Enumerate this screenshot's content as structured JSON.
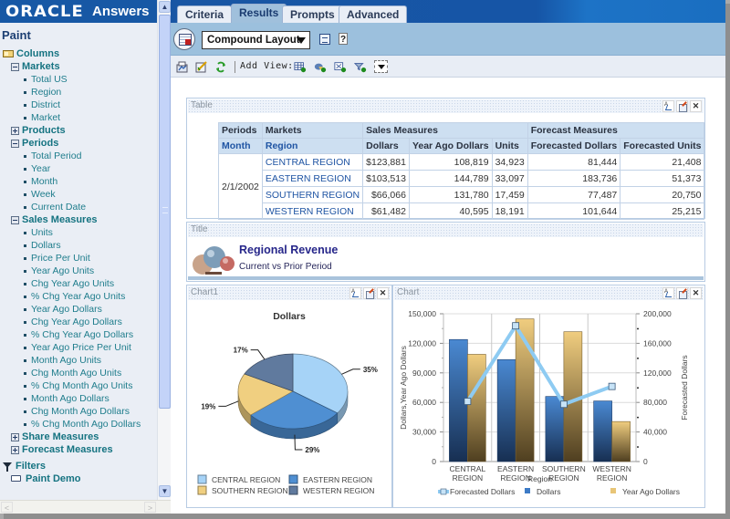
{
  "brand": {
    "logo": "ORACLE",
    "product": "Answers"
  },
  "left_panel": {
    "title": "Paint",
    "tree": [
      {
        "label": "Columns",
        "level": 0,
        "icon": "columns-folder-icon"
      },
      {
        "label": "Markets",
        "level": 1,
        "toggle": "minus"
      },
      {
        "label": "Total US",
        "level": 2
      },
      {
        "label": "Region",
        "level": 2
      },
      {
        "label": "District",
        "level": 2
      },
      {
        "label": "Market",
        "level": 2
      },
      {
        "label": "Products",
        "level": 1,
        "toggle": "plus"
      },
      {
        "label": "Periods",
        "level": 1,
        "toggle": "minus"
      },
      {
        "label": "Total Period",
        "level": 2
      },
      {
        "label": "Year",
        "level": 2
      },
      {
        "label": "Month",
        "level": 2
      },
      {
        "label": "Week",
        "level": 2
      },
      {
        "label": "Current Date",
        "level": 2
      },
      {
        "label": "Sales Measures",
        "level": 1,
        "toggle": "minus"
      },
      {
        "label": "Units",
        "level": 2
      },
      {
        "label": "Dollars",
        "level": 2
      },
      {
        "label": "Price Per Unit",
        "level": 2
      },
      {
        "label": "Year Ago Units",
        "level": 2
      },
      {
        "label": "Chg Year Ago Units",
        "level": 2
      },
      {
        "label": "% Chg Year Ago Units",
        "level": 2
      },
      {
        "label": "Year Ago Dollars",
        "level": 2
      },
      {
        "label": "Chg Year Ago Dollars",
        "level": 2
      },
      {
        "label": "% Chg Year Ago Dollars",
        "level": 2
      },
      {
        "label": "Year Ago Price Per Unit",
        "level": 2
      },
      {
        "label": "Month Ago Units",
        "level": 2
      },
      {
        "label": "Chg Month Ago Units",
        "level": 2
      },
      {
        "label": "% Chg Month Ago Units",
        "level": 2
      },
      {
        "label": "Month Ago Dollars",
        "level": 2
      },
      {
        "label": "Chg Month Ago Dollars",
        "level": 2
      },
      {
        "label": "% Chg Month Ago Dollars",
        "level": 2
      },
      {
        "label": "Share Measures",
        "level": 1,
        "toggle": "plus"
      },
      {
        "label": "Forecast Measures",
        "level": 1,
        "toggle": "plus"
      }
    ],
    "filters_label": "Filters",
    "filters_item": "Paint Demo"
  },
  "tabs": [
    {
      "label": "Criteria",
      "active": false
    },
    {
      "label": "Results",
      "active": true
    },
    {
      "label": "Prompts",
      "active": false
    },
    {
      "label": "Advanced",
      "active": false
    }
  ],
  "toolbar": {
    "layout_select": "Compound Layout",
    "help_glyph": "?",
    "add_view_label": "Add View:"
  },
  "table_view": {
    "title": "Table",
    "header_row1": {
      "periods": "Periods",
      "markets": "Markets",
      "sales": "Sales Measures",
      "forecast": "Forecast Measures"
    },
    "header_row2": [
      "Month",
      "Region",
      "Dollars",
      "Year Ago Dollars",
      "Units",
      "Forecasted Dollars",
      "Forecasted Units"
    ],
    "month": "2/1/2002",
    "rows": [
      {
        "region": "CENTRAL REGION",
        "dollars": "$123,881",
        "year_ago_dollars": "108,819",
        "units": "34,923",
        "forecasted_dollars": "81,444",
        "forecasted_units": "21,408"
      },
      {
        "region": "EASTERN REGION",
        "dollars": "$103,513",
        "year_ago_dollars": "144,789",
        "units": "33,097",
        "forecasted_dollars": "183,736",
        "forecasted_units": "51,373"
      },
      {
        "region": "SOUTHERN REGION",
        "dollars": "$66,066",
        "year_ago_dollars": "131,780",
        "units": "17,459",
        "forecasted_dollars": "77,487",
        "forecasted_units": "20,750"
      },
      {
        "region": "WESTERN REGION",
        "dollars": "$61,482",
        "year_ago_dollars": "40,595",
        "units": "18,191",
        "forecasted_dollars": "101,644",
        "forecasted_units": "25,215"
      }
    ]
  },
  "title_view": {
    "label": "Title",
    "title": "Regional Revenue",
    "subtitle": "Current vs Prior Period"
  },
  "panel_buttons": {
    "close": "✕"
  },
  "chart_data": [
    {
      "panel_label": "Chart1",
      "type": "pie",
      "title": "Dollars",
      "style": "3d",
      "slices": [
        {
          "label": "CENTRAL REGION",
          "value": 123881,
          "pct_label": "35%",
          "color": "#a6d3f7"
        },
        {
          "label": "EASTERN REGION",
          "value": 103513,
          "pct_label": "29%",
          "color": "#4f8fd2"
        },
        {
          "label": "SOUTHERN REGION",
          "value": 66066,
          "pct_label": "19%",
          "color": "#f0cf80"
        },
        {
          "label": "WESTERN REGION",
          "value": 61482,
          "pct_label": "17%",
          "color": "#607a9e"
        }
      ],
      "legend": [
        "CENTRAL REGION",
        "EASTERN REGION",
        "SOUTHERN REGION",
        "WESTERN REGION"
      ],
      "legend_position": "bottom"
    },
    {
      "panel_label": "Chart",
      "type": "bar",
      "combo": "bar-line",
      "categories": [
        "CENTRAL REGION",
        "EASTERN REGION",
        "SOUTHERN REGION",
        "WESTERN REGION"
      ],
      "categories_lines": [
        [
          "CENTRAL",
          "REGION"
        ],
        [
          "EASTERN",
          "REGION"
        ],
        [
          "SOUTHERN",
          "REGION"
        ],
        [
          "WESTERN",
          "REGION"
        ]
      ],
      "series": [
        {
          "name": "Dollars",
          "kind": "bar",
          "axis": "left",
          "values": [
            123881,
            103513,
            66066,
            61482
          ],
          "color": "#3d7bc6"
        },
        {
          "name": "Year Ago Dollars",
          "kind": "bar",
          "axis": "left",
          "values": [
            108819,
            144789,
            131780,
            40595
          ],
          "color": "#e8c577"
        },
        {
          "name": "Forecasted Dollars",
          "kind": "line",
          "axis": "right",
          "values": [
            81444,
            183736,
            77487,
            101644
          ],
          "color": "#8ecbf2"
        }
      ],
      "xlabel": "Region",
      "ylabel": "Dollars,Year Ago Dollars",
      "y2label": "Forecasted Dollars",
      "ylim": [
        0,
        150000
      ],
      "y_ticks": [
        "0",
        "30,000",
        "60,000",
        "90,000",
        "120,000",
        "150,000"
      ],
      "y2lim": [
        0,
        200000
      ],
      "y2_ticks": [
        "0",
        "40,000",
        "80,000",
        "120,000",
        "160,000",
        "200,000"
      ],
      "legend": [
        "Forecasted Dollars",
        "Dollars",
        "Year Ago Dollars"
      ],
      "legend_position": "bottom",
      "grid": true
    }
  ]
}
